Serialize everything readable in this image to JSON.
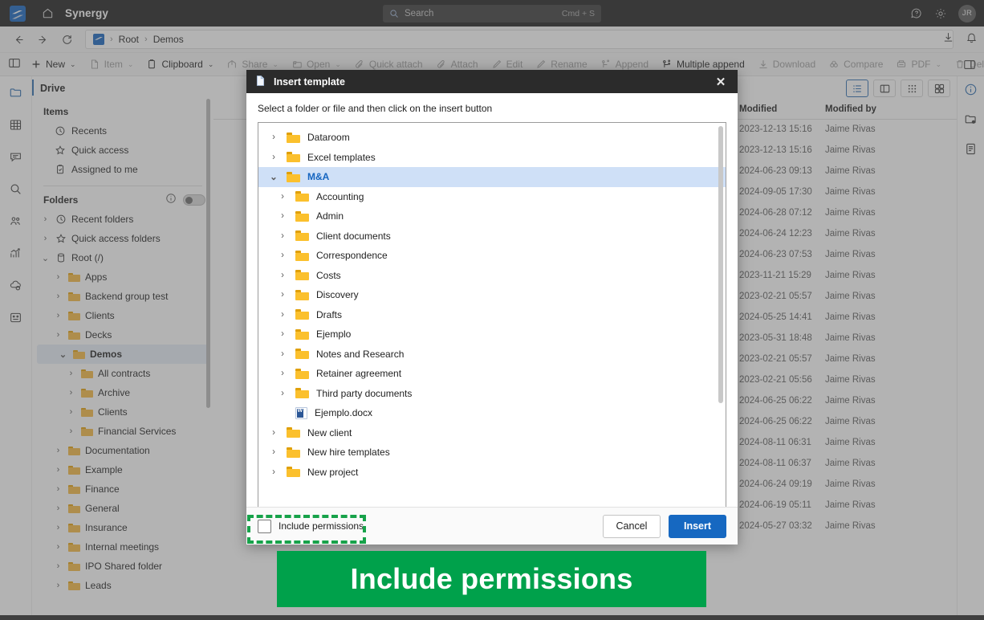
{
  "topbar": {
    "app_title": "Synergy",
    "home_icon": "home-icon",
    "search_placeholder": "Search",
    "search_shortcut": "Cmd + S",
    "help_icon": "help-icon",
    "settings_icon": "gear-icon",
    "avatar_initials": "JR"
  },
  "navbar": {
    "back_icon": "arrow-left-icon",
    "forward_icon": "arrow-right-icon",
    "refresh_icon": "refresh-icon",
    "breadcrumb": [
      "Root",
      "Demos"
    ],
    "download_icon": "download-icon",
    "notifications_icon": "bell-icon"
  },
  "toolbar": {
    "pane_icon": "split-pane-icon",
    "items": [
      {
        "label": "New",
        "icon": "plus-icon",
        "chevron": true,
        "enabled": true
      },
      {
        "label": "Item",
        "icon": "item-icon",
        "chevron": true,
        "enabled": false
      },
      {
        "label": "Clipboard",
        "icon": "clipboard-icon",
        "chevron": true,
        "enabled": true
      },
      {
        "label": "Share",
        "icon": "share-icon",
        "chevron": true,
        "enabled": false
      },
      {
        "label": "Open",
        "icon": "open-icon",
        "chevron": true,
        "enabled": false
      },
      {
        "label": "Quick attach",
        "icon": "paperclip-icon",
        "chevron": false,
        "enabled": false
      },
      {
        "label": "Attach",
        "icon": "paperclip-icon",
        "chevron": false,
        "enabled": false
      },
      {
        "label": "Edit",
        "icon": "pencil-icon",
        "chevron": false,
        "enabled": false
      },
      {
        "label": "Rename",
        "icon": "pencil-icon",
        "chevron": false,
        "enabled": false
      },
      {
        "label": "Append",
        "icon": "append-icon",
        "chevron": false,
        "enabled": false
      },
      {
        "label": "Multiple append",
        "icon": "multiple-append-icon",
        "chevron": false,
        "enabled": true
      },
      {
        "label": "Download",
        "icon": "download-icon",
        "chevron": false,
        "enabled": false
      },
      {
        "label": "Compare",
        "icon": "compare-icon",
        "chevron": false,
        "enabled": false
      },
      {
        "label": "PDF",
        "icon": "pdf-icon",
        "chevron": true,
        "enabled": false
      },
      {
        "label": "Delete",
        "icon": "trash-icon",
        "chevron": false,
        "enabled": false
      }
    ],
    "right_pane_icon": "split-pane-icon"
  },
  "rail": {
    "items": [
      {
        "icon": "drive-folder-icon",
        "active": true
      },
      {
        "icon": "grid-table-icon",
        "active": false
      },
      {
        "icon": "chat-icon",
        "active": false
      },
      {
        "icon": "search-icon",
        "active": false
      },
      {
        "icon": "team-icon",
        "active": false
      },
      {
        "icon": "analytics-icon",
        "active": false
      },
      {
        "icon": "cloud-sync-icon",
        "active": false
      },
      {
        "icon": "apps-icon",
        "active": false
      }
    ]
  },
  "sidebar": {
    "header": "Drive",
    "items_section": "Items",
    "items": [
      {
        "label": "Recents",
        "icon": "clock-icon"
      },
      {
        "label": "Quick access",
        "icon": "star-icon"
      },
      {
        "label": "Assigned to me",
        "icon": "clipboard-check-icon"
      }
    ],
    "folders_section": "Folders",
    "info_icon": "info-icon",
    "toggle_icon": "toggle-switch",
    "tree": [
      {
        "label": "Recent folders",
        "indent": 0,
        "caret": "›",
        "icon": "clock-icon",
        "selected": false
      },
      {
        "label": "Quick access folders",
        "indent": 0,
        "caret": "›",
        "icon": "star-icon",
        "selected": false
      },
      {
        "label": "Root (/)",
        "indent": 0,
        "caret": "⌄",
        "icon": "database-icon",
        "selected": false
      },
      {
        "label": "Apps",
        "indent": 1,
        "caret": "›",
        "icon": "folder-icon",
        "selected": false
      },
      {
        "label": "Backend group test",
        "indent": 1,
        "caret": "›",
        "icon": "folder-icon",
        "selected": false
      },
      {
        "label": "Clients",
        "indent": 1,
        "caret": "›",
        "icon": "folder-icon",
        "selected": false
      },
      {
        "label": "Decks",
        "indent": 1,
        "caret": "›",
        "icon": "folder-icon",
        "selected": false
      },
      {
        "label": "Demos",
        "indent": 1,
        "caret": "⌄",
        "icon": "folder-icon",
        "selected": true
      },
      {
        "label": "All contracts",
        "indent": 2,
        "caret": "›",
        "icon": "folder-icon",
        "selected": false
      },
      {
        "label": "Archive",
        "indent": 2,
        "caret": "›",
        "icon": "folder-icon",
        "selected": false
      },
      {
        "label": "Clients",
        "indent": 2,
        "caret": "›",
        "icon": "folder-icon",
        "selected": false
      },
      {
        "label": "Financial Services",
        "indent": 2,
        "caret": "›",
        "icon": "folder-icon",
        "selected": false
      },
      {
        "label": "Documentation",
        "indent": 1,
        "caret": "›",
        "icon": "folder-icon",
        "selected": false
      },
      {
        "label": "Example",
        "indent": 1,
        "caret": "›",
        "icon": "folder-icon",
        "selected": false
      },
      {
        "label": "Finance",
        "indent": 1,
        "caret": "›",
        "icon": "folder-icon",
        "selected": false
      },
      {
        "label": "General",
        "indent": 1,
        "caret": "›",
        "icon": "folder-icon",
        "selected": false
      },
      {
        "label": "Insurance",
        "indent": 1,
        "caret": "›",
        "icon": "folder-icon",
        "selected": false
      },
      {
        "label": "Internal meetings",
        "indent": 1,
        "caret": "›",
        "icon": "folder-icon",
        "selected": false
      },
      {
        "label": "IPO Shared folder",
        "indent": 1,
        "caret": "›",
        "icon": "folder-icon",
        "selected": false
      },
      {
        "label": "Leads",
        "indent": 1,
        "caret": "›",
        "icon": "folder-icon",
        "selected": false
      }
    ]
  },
  "main": {
    "view_toggles": [
      {
        "icon": "list-view-icon",
        "active": true
      },
      {
        "icon": "split-view-icon",
        "active": false
      },
      {
        "icon": "dots-grid-view-icon",
        "active": false
      },
      {
        "icon": "tile-view-icon",
        "active": false
      }
    ],
    "columns": [
      "Modified",
      "Modified by"
    ],
    "rows": [
      {
        "modified": "2023-12-13 15:16",
        "modified_by": "Jaime Rivas"
      },
      {
        "modified": "2023-12-13 15:16",
        "modified_by": "Jaime Rivas"
      },
      {
        "modified": "2024-06-23 09:13",
        "modified_by": "Jaime Rivas"
      },
      {
        "modified": "2024-09-05 17:30",
        "modified_by": "Jaime Rivas"
      },
      {
        "modified": "2024-06-28 07:12",
        "modified_by": "Jaime Rivas"
      },
      {
        "modified": "2024-06-24 12:23",
        "modified_by": "Jaime Rivas"
      },
      {
        "modified": "2024-06-23 07:53",
        "modified_by": "Jaime Rivas"
      },
      {
        "modified": "2023-11-21 15:29",
        "modified_by": "Jaime Rivas"
      },
      {
        "modified": "2023-02-21 05:57",
        "modified_by": "Jaime Rivas"
      },
      {
        "modified": "2024-05-25 14:41",
        "modified_by": "Jaime Rivas"
      },
      {
        "modified": "2023-05-31 18:48",
        "modified_by": "Jaime Rivas"
      },
      {
        "modified": "2023-02-21 05:57",
        "modified_by": "Jaime Rivas"
      },
      {
        "modified": "2023-02-21 05:56",
        "modified_by": "Jaime Rivas"
      },
      {
        "modified": "2024-06-25 06:22",
        "modified_by": "Jaime Rivas"
      },
      {
        "modified": "2024-06-25 06:22",
        "modified_by": "Jaime Rivas"
      },
      {
        "modified": "2024-08-11 06:31",
        "modified_by": "Jaime Rivas"
      },
      {
        "modified": "2024-08-11 06:37",
        "modified_by": "Jaime Rivas"
      },
      {
        "modified": "2024-06-24 09:19",
        "modified_by": "Jaime Rivas"
      },
      {
        "modified": "2024-06-19 05:11",
        "modified_by": "Jaime Rivas"
      },
      {
        "modified": "2024-05-27 03:32",
        "modified_by": "Jaime Rivas"
      }
    ]
  },
  "right_rail": {
    "items": [
      {
        "icon": "info-circle-icon",
        "active": true
      },
      {
        "icon": "folder-lock-icon",
        "active": false
      },
      {
        "icon": "document-icon",
        "active": false
      }
    ]
  },
  "dialog": {
    "title": "Insert template",
    "title_icon": "document-insert-icon",
    "close_icon": "close-icon",
    "subtitle": "Select a folder or file and then click on the insert button",
    "tree": [
      {
        "label": "Dataroom",
        "indent": 0,
        "caret": "›",
        "icon": "folder-icon",
        "selected": false
      },
      {
        "label": "Excel templates",
        "indent": 0,
        "caret": "›",
        "icon": "folder-icon",
        "selected": false
      },
      {
        "label": "M&A",
        "indent": 0,
        "caret": "⌄",
        "icon": "folder-icon",
        "selected": true
      },
      {
        "label": "Accounting",
        "indent": 1,
        "caret": "›",
        "icon": "folder-icon",
        "selected": false
      },
      {
        "label": "Admin",
        "indent": 1,
        "caret": "›",
        "icon": "folder-icon",
        "selected": false
      },
      {
        "label": "Client documents",
        "indent": 1,
        "caret": "›",
        "icon": "folder-icon",
        "selected": false
      },
      {
        "label": "Correspondence",
        "indent": 1,
        "caret": "›",
        "icon": "folder-icon",
        "selected": false
      },
      {
        "label": "Costs",
        "indent": 1,
        "caret": "›",
        "icon": "folder-icon",
        "selected": false
      },
      {
        "label": "Discovery",
        "indent": 1,
        "caret": "›",
        "icon": "folder-icon",
        "selected": false
      },
      {
        "label": "Drafts",
        "indent": 1,
        "caret": "›",
        "icon": "folder-icon",
        "selected": false
      },
      {
        "label": "Ejemplo",
        "indent": 1,
        "caret": "›",
        "icon": "folder-icon",
        "selected": false
      },
      {
        "label": "Notes and Research",
        "indent": 1,
        "caret": "›",
        "icon": "folder-icon",
        "selected": false
      },
      {
        "label": "Retainer agreement",
        "indent": 1,
        "caret": "›",
        "icon": "folder-icon",
        "selected": false
      },
      {
        "label": "Third party documents",
        "indent": 1,
        "caret": "›",
        "icon": "folder-icon",
        "selected": false
      },
      {
        "label": "Ejemplo.docx",
        "indent": 1,
        "caret": "",
        "icon": "word-doc-icon",
        "selected": false
      },
      {
        "label": "New client",
        "indent": 0,
        "caret": "›",
        "icon": "folder-icon",
        "selected": false
      },
      {
        "label": "New hire templates",
        "indent": 0,
        "caret": "›",
        "icon": "folder-icon",
        "selected": false
      },
      {
        "label": "New project",
        "indent": 0,
        "caret": "›",
        "icon": "folder-icon",
        "selected": false
      }
    ],
    "checkbox_label": "Include permissions",
    "checkbox_checked": false,
    "cancel_label": "Cancel",
    "insert_label": "Insert"
  },
  "annotation": {
    "banner_text": "Include permissions",
    "highlight_color": "#17a24a",
    "banner_color": "#00a14b"
  }
}
